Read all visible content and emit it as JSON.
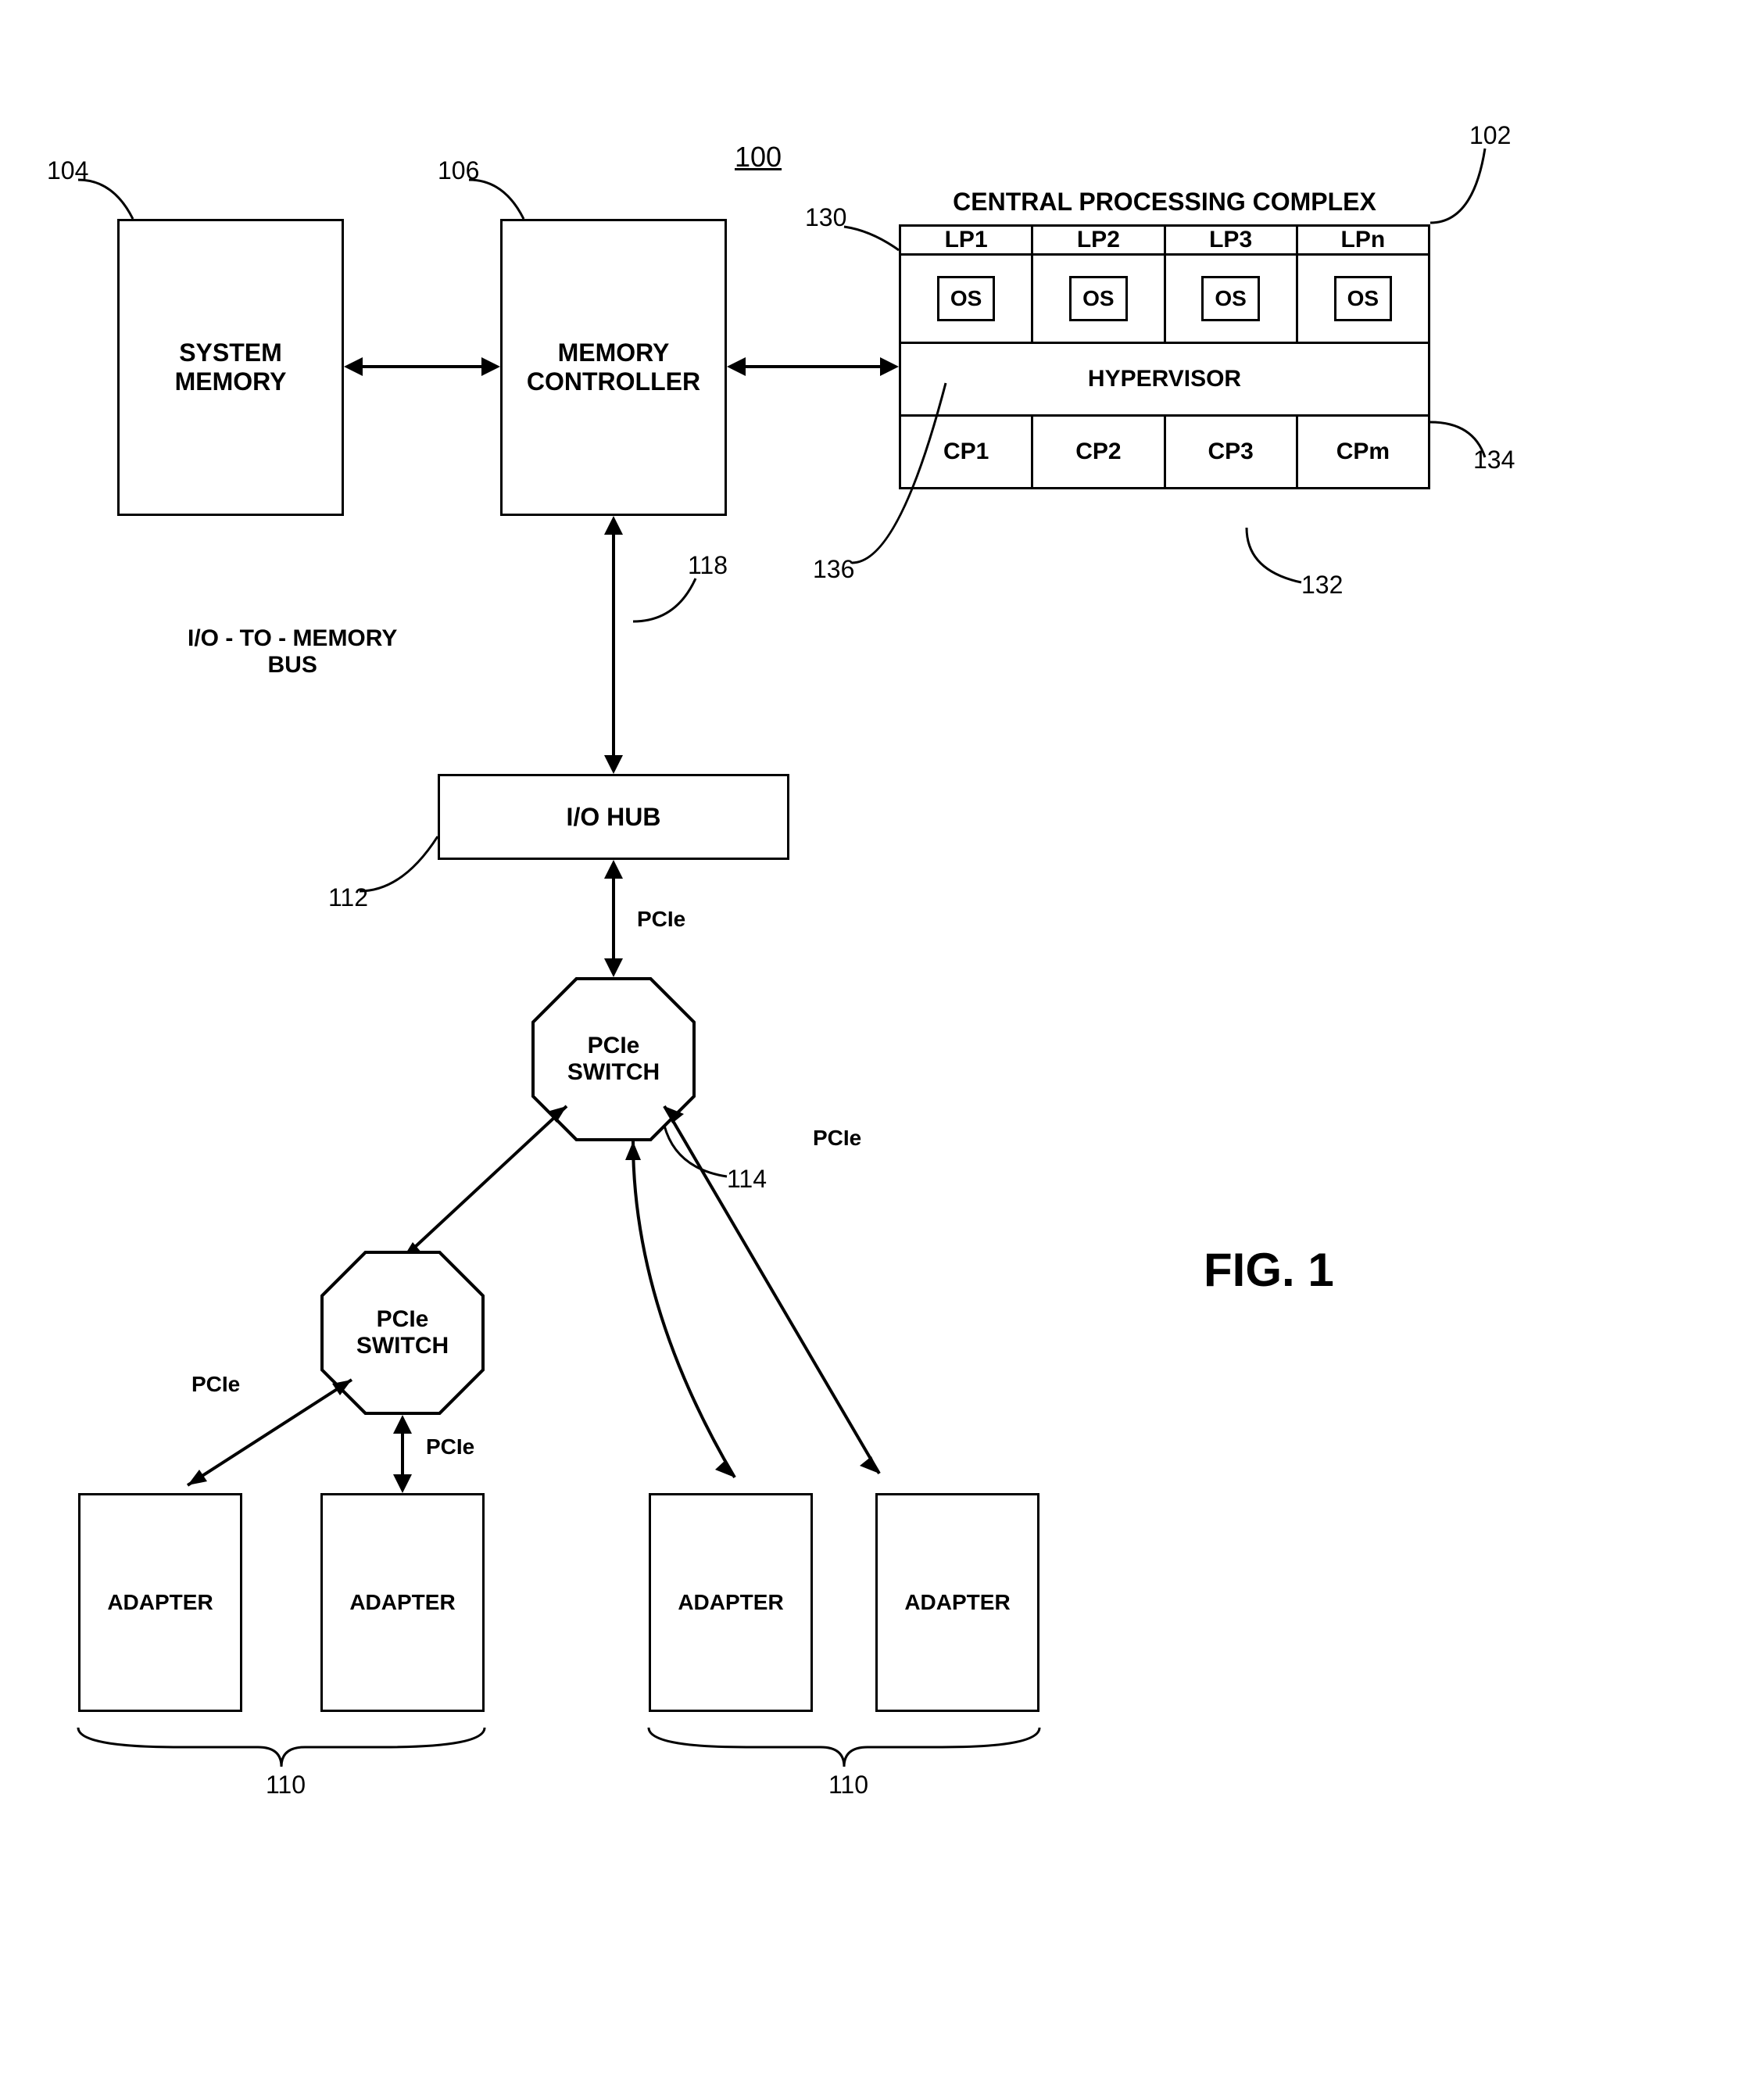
{
  "refs": {
    "system": "100",
    "cpc": "102",
    "system_memory": "104",
    "memory_controller": "106",
    "adapter_group_left": "110",
    "adapter_group_right": "110",
    "io_hub": "112",
    "switch_under": "114",
    "bus": "118",
    "lp_row": "130",
    "cp3": "132",
    "hypervisor": "134",
    "os": "136"
  },
  "blocks": {
    "system_memory": "SYSTEM\nMEMORY",
    "memory_controller": "MEMORY\nCONTROLLER",
    "io_hub": "I/O HUB",
    "pcie_switch": "PCIe\nSWITCH",
    "adapter": "ADAPTER"
  },
  "cpc": {
    "title": "CENTRAL PROCESSING COMPLEX",
    "lps": [
      "LP1",
      "LP2",
      "LP3",
      "LPn"
    ],
    "os": "OS",
    "hypervisor": "HYPERVISOR",
    "cps": [
      "CP1",
      "CP2",
      "CP3",
      "CPm"
    ]
  },
  "bus_labels": {
    "io_to_memory": "I/O - TO - MEMORY\nBUS",
    "pcie": "PCIe"
  },
  "figure": "FIG. 1"
}
